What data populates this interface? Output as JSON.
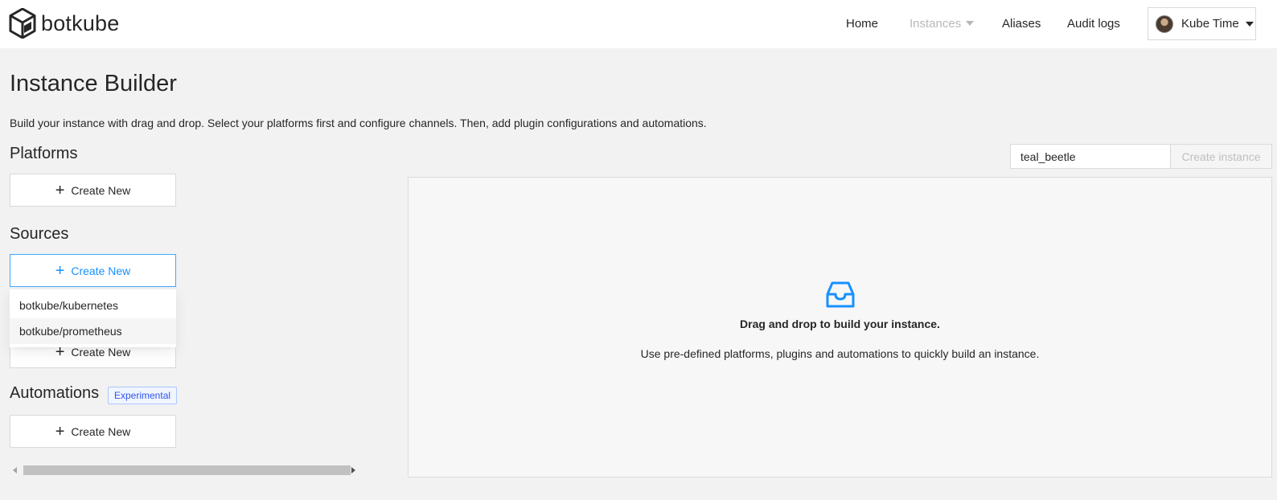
{
  "header": {
    "logo_text": "botkube",
    "nav": {
      "home": "Home",
      "instances": "Instances",
      "aliases": "Aliases",
      "audit_logs": "Audit logs"
    },
    "user": {
      "name": "Kube Time"
    }
  },
  "page": {
    "title": "Instance Builder",
    "description": "Build your instance with drag and drop. Select your platforms first and configure channels. Then, add plugin configurations and automations."
  },
  "sidebar": {
    "platforms": {
      "title": "Platforms",
      "button": "Create New"
    },
    "sources": {
      "title": "Sources",
      "button": "Create New",
      "dropdown": [
        "botkube/kubernetes",
        "botkube/prometheus"
      ]
    },
    "executors": {
      "button": "Create New"
    },
    "automations": {
      "title": "Automations",
      "badge": "Experimental",
      "button": "Create New"
    }
  },
  "instance": {
    "name_value": "teal_beetle",
    "create_label": "Create instance"
  },
  "canvas": {
    "icon": "inbox-icon",
    "empty_title": "Drag and drop to build your instance.",
    "empty_desc": "Use pre-defined platforms, plugins and automations to quickly build an instance."
  },
  "colors": {
    "accent": "#1890ff",
    "badge_text": "#2f54eb",
    "background": "#f2f2f2"
  }
}
